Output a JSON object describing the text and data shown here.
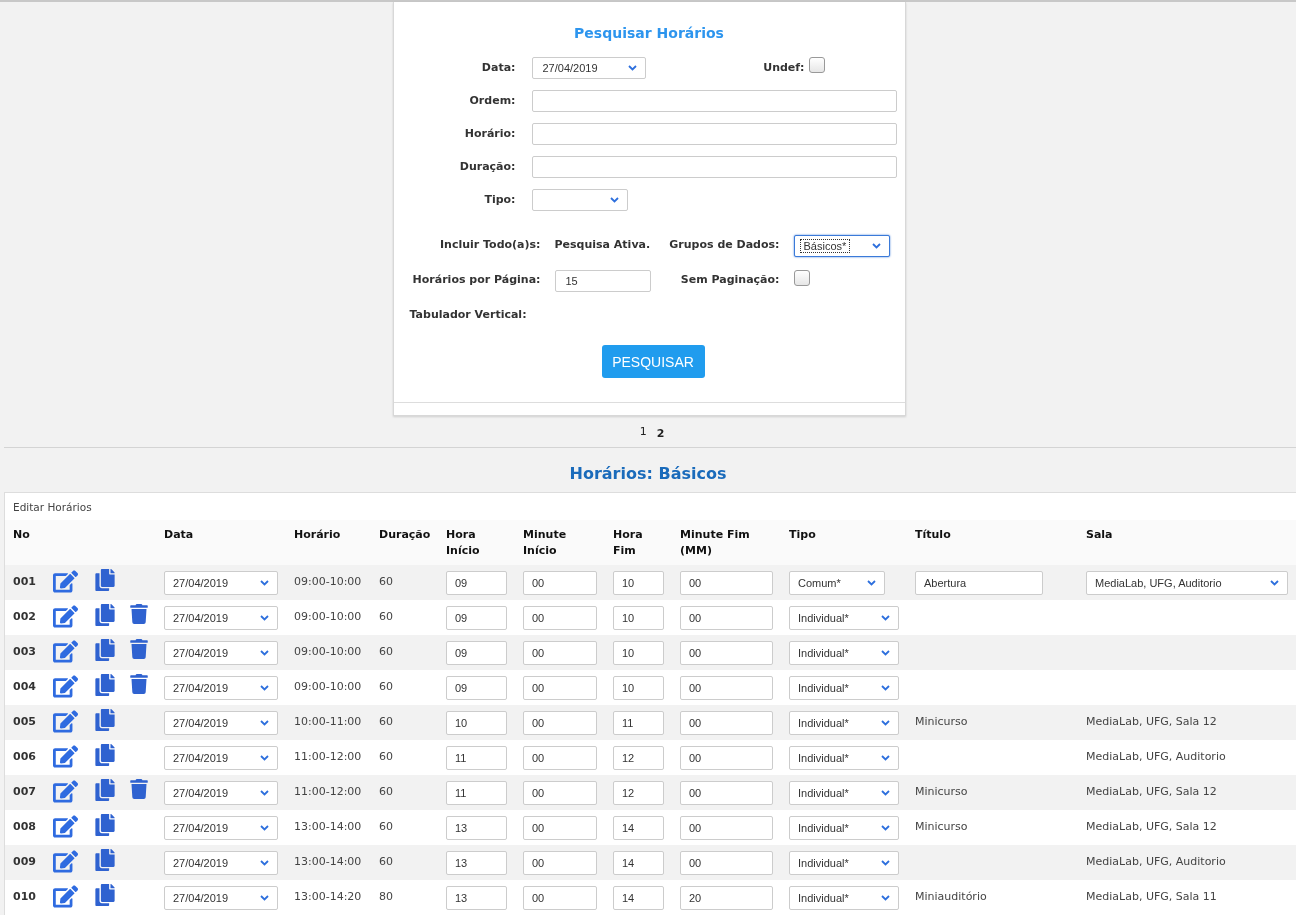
{
  "search_panel": {
    "title": "Pesquisar Horários",
    "fields": [
      {
        "kind": "select",
        "label": "Data:",
        "value": "27/04/2019"
      },
      {
        "kind": "text",
        "label": "Ordem:"
      },
      {
        "kind": "text",
        "label": "Horário:"
      },
      {
        "kind": "text",
        "label": "Duração:"
      },
      {
        "kind": "select",
        "label": "Tipo:"
      }
    ],
    "undef": {
      "label": "Undef:",
      "checked": false
    },
    "include_label": "Incluir Todo(a)s:",
    "include_value": "Pesquisa Ativa.",
    "data_groups": {
      "label": "Grupos de Dados:",
      "value": "Básicos*"
    },
    "per_page": {
      "label": "Horários por Página:",
      "value": "15"
    },
    "no_paging": {
      "label": "Sem Paginação:",
      "checked": false
    },
    "vertical_tab_label": "Tabulador Vertical:",
    "button": "PESQUISAR"
  },
  "pagination": [
    {
      "label": "1",
      "selected": false
    },
    {
      "label": "2",
      "selected": true
    }
  ],
  "heading": "Horários: Básicos",
  "table": {
    "caption": "Editar Horários",
    "columns": [
      "No",
      "Data",
      "Horário",
      "Duração",
      "Hora Início",
      "Minute Início",
      "Hora Fim",
      "Minute Fim (MM)",
      "Tipo",
      "Título",
      "Sala"
    ],
    "rows": [
      {
        "no": "001",
        "deletable": false,
        "editable": true,
        "date": "27/04/2019",
        "time": "09:00-10:00",
        "duration": "60",
        "hour_start": "09",
        "min_start": "00",
        "hour_end": "10",
        "min_end": "00",
        "type": "Comum*",
        "title": "Abertura",
        "room": "MediaLab, UFG, Auditorio"
      },
      {
        "no": "002",
        "deletable": true,
        "editable": false,
        "date": "27/04/2019",
        "time": "09:00-10:00",
        "duration": "60",
        "hour_start": "09",
        "min_start": "00",
        "hour_end": "10",
        "min_end": "00",
        "type": "Individual*"
      },
      {
        "no": "003",
        "deletable": true,
        "editable": false,
        "date": "27/04/2019",
        "time": "09:00-10:00",
        "duration": "60",
        "hour_start": "09",
        "min_start": "00",
        "hour_end": "10",
        "min_end": "00",
        "type": "Individual*"
      },
      {
        "no": "004",
        "deletable": true,
        "editable": false,
        "date": "27/04/2019",
        "time": "09:00-10:00",
        "duration": "60",
        "hour_start": "09",
        "min_start": "00",
        "hour_end": "10",
        "min_end": "00",
        "type": "Individual*"
      },
      {
        "no": "005",
        "deletable": false,
        "editable": false,
        "date": "27/04/2019",
        "time": "10:00-11:00",
        "duration": "60",
        "hour_start": "10",
        "min_start": "00",
        "hour_end": "11",
        "min_end": "00",
        "type": "Individual*",
        "title": "Minicurso",
        "room": "MediaLab, UFG, Sala 12"
      },
      {
        "no": "006",
        "deletable": false,
        "editable": false,
        "date": "27/04/2019",
        "time": "11:00-12:00",
        "duration": "60",
        "hour_start": "11",
        "min_start": "00",
        "hour_end": "12",
        "min_end": "00",
        "type": "Individual*",
        "room": "MediaLab, UFG, Auditorio"
      },
      {
        "no": "007",
        "deletable": true,
        "editable": false,
        "date": "27/04/2019",
        "time": "11:00-12:00",
        "duration": "60",
        "hour_start": "11",
        "min_start": "00",
        "hour_end": "12",
        "min_end": "00",
        "type": "Individual*",
        "title": "Minicurso",
        "room": "MediaLab, UFG, Sala 12"
      },
      {
        "no": "008",
        "deletable": false,
        "editable": false,
        "date": "27/04/2019",
        "time": "13:00-14:00",
        "duration": "60",
        "hour_start": "13",
        "min_start": "00",
        "hour_end": "14",
        "min_end": "00",
        "type": "Individual*",
        "title": "Minicurso",
        "room": "MediaLab, UFG, Sala 12"
      },
      {
        "no": "009",
        "deletable": false,
        "editable": false,
        "date": "27/04/2019",
        "time": "13:00-14:00",
        "duration": "60",
        "hour_start": "13",
        "min_start": "00",
        "hour_end": "14",
        "min_end": "00",
        "type": "Individual*",
        "room": "MediaLab, UFG, Auditorio"
      },
      {
        "no": "010",
        "deletable": false,
        "editable": false,
        "date": "27/04/2019",
        "time": "13:00-14:20",
        "duration": "80",
        "hour_start": "13",
        "min_start": "00",
        "hour_end": "14",
        "min_end": "20",
        "type": "Individual*",
        "title": "Miniauditório",
        "room": "MediaLab, UFG, Sala 11"
      }
    ]
  }
}
